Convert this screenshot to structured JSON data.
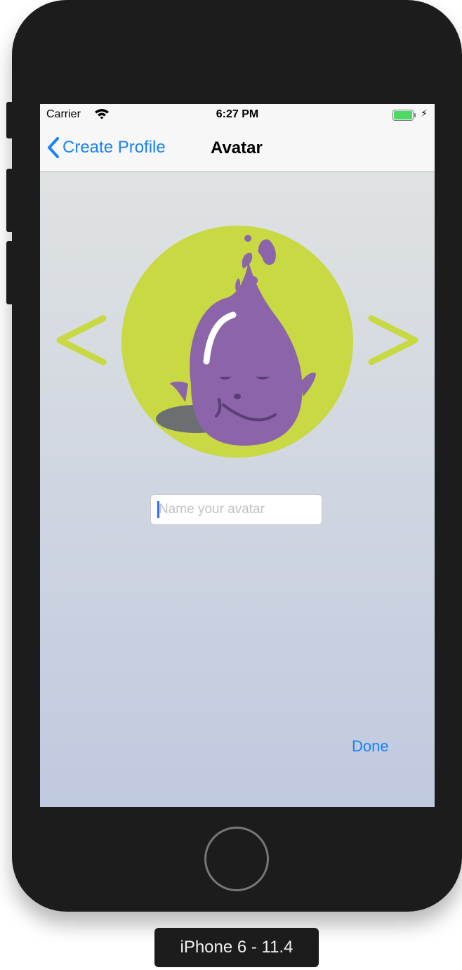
{
  "device": {
    "label": "iPhone 6 - 11.4"
  },
  "status_bar": {
    "carrier": "Carrier",
    "time": "6:27 PM"
  },
  "nav": {
    "back_label": "Create Profile",
    "title": "Avatar"
  },
  "avatar_picker": {
    "prev_label": "<",
    "next_label": ">",
    "name_input": {
      "value": "",
      "placeholder": "Name your avatar"
    }
  },
  "done_label": "Done",
  "colors": {
    "accent_blue": "#1a82f7",
    "avatar_circle": "#c8d943",
    "avatar_body": "#8b64aa",
    "arrow_color": "#c8d943",
    "battery_green": "#4cd964"
  },
  "icons": [
    "wifi-icon",
    "battery-icon",
    "charging-bolt-icon",
    "chevron-left-icon",
    "avatar-illustration",
    "home-button"
  ]
}
